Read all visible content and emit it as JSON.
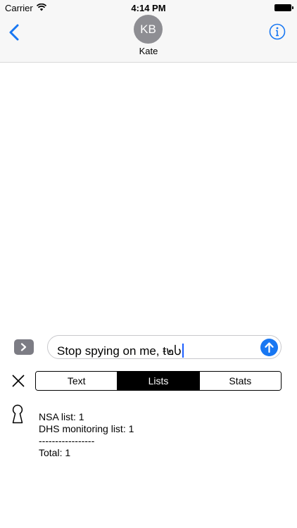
{
  "status_bar": {
    "carrier": "Carrier",
    "time": "4:14 PM"
  },
  "header": {
    "avatar_initials": "KB",
    "contact_name": "Kate"
  },
  "composer": {
    "text": "Stop spying on me, ŧ๒Ⴑ"
  },
  "segmented_control": {
    "items": [
      {
        "label": "Text"
      },
      {
        "label": "Lists"
      },
      {
        "label": "Stats"
      }
    ],
    "selected": "Lists"
  },
  "lists_panel": {
    "lines": [
      "NSA list: 1",
      "DHS monitoring list: 1",
      "-----------------",
      "Total: 1"
    ]
  },
  "colors": {
    "accent": "#1877f2",
    "avatar": "#8e8e93",
    "selected_segment": "#000000"
  },
  "icons": [
    "wifi-icon",
    "battery-icon",
    "back-chevron-icon",
    "info-icon",
    "expand-chevron-icon",
    "send-arrow-icon",
    "close-icon",
    "keyhole-icon"
  ]
}
